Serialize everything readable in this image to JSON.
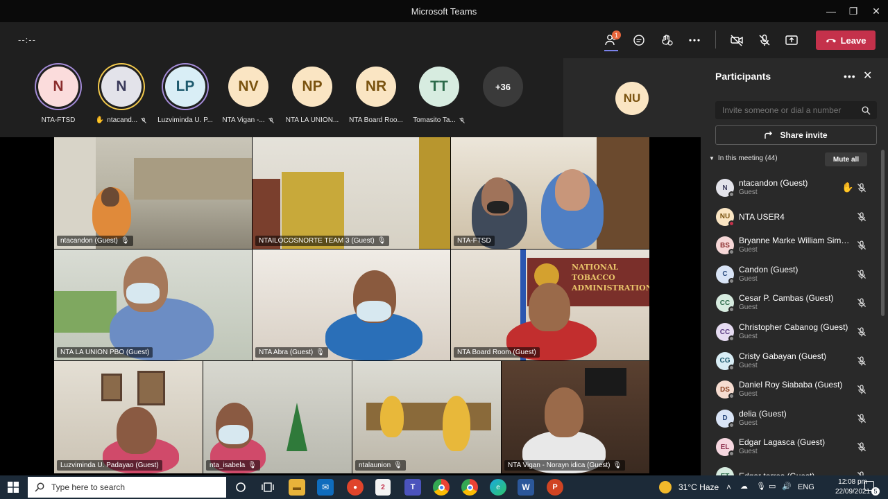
{
  "window": {
    "title": "Microsoft Teams",
    "minimize": "—",
    "maximize": "❐",
    "close": "✕"
  },
  "toolbar": {
    "timer": "--:--",
    "people_badge": "1",
    "leave_label": "Leave"
  },
  "strip": [
    {
      "initials": "N",
      "name": "NTA-FTSD",
      "bg": "#fbdcdc",
      "fg": "#8a2c2c",
      "ring": "#a48bd8",
      "hand": false,
      "muted": false
    },
    {
      "initials": "N",
      "name": "ntacand...",
      "bg": "#e3e3ea",
      "fg": "#3a3a5a",
      "ring": "#f2c94c",
      "hand": true,
      "muted": true
    },
    {
      "initials": "LP",
      "name": "Luzviminda U. P...",
      "bg": "#d9eef6",
      "fg": "#1e5a6e",
      "ring": "#a48bd8",
      "hand": false,
      "muted": false
    },
    {
      "initials": "NV",
      "name": "NTA Vigan -...",
      "bg": "#fae5c3",
      "fg": "#7a5310",
      "ring": "",
      "hand": false,
      "muted": true
    },
    {
      "initials": "NP",
      "name": "NTA LA UNION...",
      "bg": "#fae5c3",
      "fg": "#7a5310",
      "ring": "",
      "hand": false,
      "muted": false
    },
    {
      "initials": "NR",
      "name": "NTA Board Roo...",
      "bg": "#fae5c3",
      "fg": "#7a5310",
      "ring": "",
      "hand": false,
      "muted": false
    },
    {
      "initials": "TT",
      "name": "Tomasito Ta...",
      "bg": "#d7ece0",
      "fg": "#2d6a4a",
      "ring": "",
      "hand": false,
      "muted": true
    },
    {
      "initials": "+36",
      "name": "",
      "bg": "#3a3a3a",
      "fg": "#ffffff",
      "ring": "",
      "hand": false,
      "muted": false
    }
  ],
  "spotlight": {
    "initials": "NU"
  },
  "tiles": [
    {
      "label": "ntacandon (Guest)",
      "muted": true
    },
    {
      "label": "NTAILOCOSNORTE TEAM 3 (Guest)",
      "muted": true
    },
    {
      "label": "NTA-FTSD",
      "muted": false
    },
    {
      "label": "NTA LA UNION PBO (Guest)",
      "muted": false
    },
    {
      "label": "NTA Abra (Guest)",
      "muted": true
    },
    {
      "label": "NTA Board Room (Guest)",
      "muted": false
    },
    {
      "label": "Luzviminda U. Padayao (Guest)",
      "muted": false
    },
    {
      "label": "nta_isabela",
      "muted": true
    },
    {
      "label": "ntalaunion",
      "muted": true
    },
    {
      "label": "NTA Vigan - Norayn idica (Guest)",
      "muted": true
    }
  ],
  "signage": {
    "line1": "NATIONAL",
    "line2": "TOBACCO",
    "line3": "ADMINISTRATION"
  },
  "panel": {
    "title": "Participants",
    "search_placeholder": "Invite someone or dial a number",
    "share_label": "Share invite",
    "section_label": "In this meeting (44)",
    "mute_all": "Mute all",
    "participants": [
      {
        "initials": "N",
        "name": "ntacandon (Guest)",
        "role": "Guest",
        "bg": "#e3e3ea",
        "fg": "#3a3a5a",
        "hand": true,
        "status": "#8a8a8a"
      },
      {
        "initials": "NU",
        "name": "NTA USER4",
        "role": "",
        "bg": "#fae5c3",
        "fg": "#7a5310",
        "hand": false,
        "status": "#c4314b"
      },
      {
        "initials": "BS",
        "name": "Bryanne Marke William Simeo...",
        "role": "Guest",
        "bg": "#f6d7d7",
        "fg": "#8a2c2c",
        "hand": false,
        "status": "#8a8a8a"
      },
      {
        "initials": "C",
        "name": "Candon (Guest)",
        "role": "Guest",
        "bg": "#d9e4f6",
        "fg": "#2a4a7e",
        "hand": false,
        "status": "#8a8a8a"
      },
      {
        "initials": "CC",
        "name": "Cesar P. Cambas (Guest)",
        "role": "Guest",
        "bg": "#d7ece0",
        "fg": "#2d6a4a",
        "hand": false,
        "status": "#8a8a8a"
      },
      {
        "initials": "CC",
        "name": "Christopher Cabanog (Guest)",
        "role": "Guest",
        "bg": "#e6dcf2",
        "fg": "#5a3a82",
        "hand": false,
        "status": "#8a8a8a"
      },
      {
        "initials": "CG",
        "name": "Cristy Gabayan (Guest)",
        "role": "Guest",
        "bg": "#d9eef6",
        "fg": "#1e5a6e",
        "hand": false,
        "status": "#8a8a8a"
      },
      {
        "initials": "DS",
        "name": "Daniel Roy Siababa (Guest)",
        "role": "Guest",
        "bg": "#f6dcd0",
        "fg": "#8a4020",
        "hand": false,
        "status": "#8a8a8a"
      },
      {
        "initials": "D",
        "name": "delia (Guest)",
        "role": "Guest",
        "bg": "#d9e4f6",
        "fg": "#2a4a7e",
        "hand": false,
        "status": "#8a8a8a"
      },
      {
        "initials": "EL",
        "name": "Edgar Lagasca (Guest)",
        "role": "Guest",
        "bg": "#f6d7e0",
        "fg": "#8a2c4a",
        "hand": false,
        "status": "#8a8a8a"
      },
      {
        "initials": "ET",
        "name": "Edgar torres (Guest)",
        "role": "",
        "bg": "#d7ece0",
        "fg": "#2d6a4a",
        "hand": false,
        "status": "#8a8a8a"
      }
    ]
  },
  "taskbar": {
    "search_placeholder": "Type here to search",
    "weather": "31°C  Haze",
    "lang": "ENG",
    "time": "12:08 pm",
    "date": "22/09/2021",
    "notif": "5"
  }
}
